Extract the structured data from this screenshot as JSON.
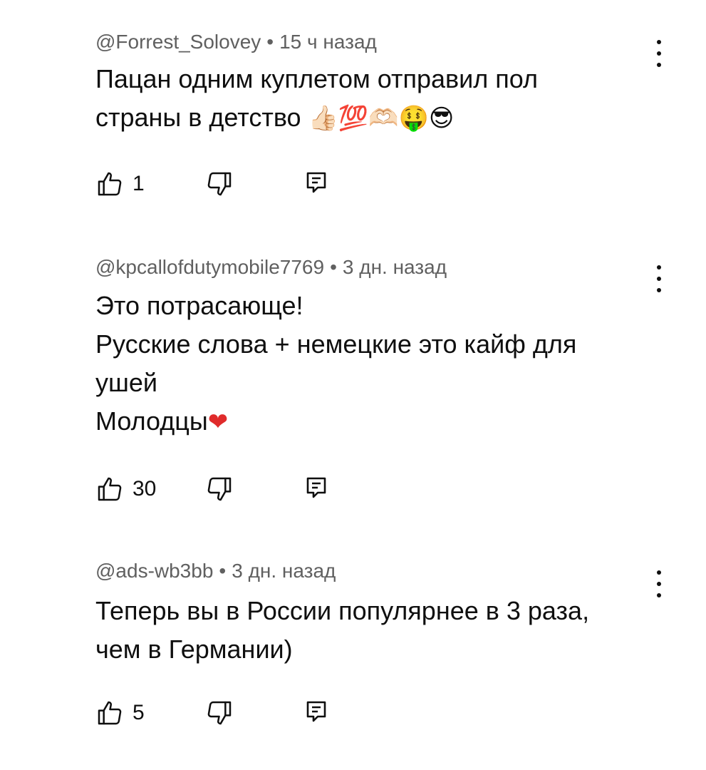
{
  "comments": [
    {
      "author": "@Forrest_Solovey",
      "time": "15 ч назад",
      "text": "Пацан одним куплетом отправил пол\nстраны в детство",
      "emoji": "👍🏻💯🫶🏻🤑😎",
      "likes": "1"
    },
    {
      "author": "@kpcallofdutymobile7769",
      "time": "3 дн. назад",
      "text": "Это потрасающе!\nРусские слова + немецкие это кайф для\nушей\nМолодцы",
      "emoji": "❤",
      "likes": "30"
    },
    {
      "author": "@ads-wb3bb",
      "time": "3 дн. назад",
      "text": "Теперь вы в России популярнее в 3 раза,\nчем в Германии)",
      "emoji": "",
      "likes": "5"
    }
  ],
  "separator": "•",
  "icons": {
    "like": "thumbs-up-icon",
    "dislike": "thumbs-down-icon",
    "reply": "reply-comment-icon",
    "menu": "more-vertical-icon"
  },
  "colors": {
    "text": "#0f0f0f",
    "meta": "#606060",
    "background": "#ffffff",
    "heart": "#e02b2b"
  }
}
